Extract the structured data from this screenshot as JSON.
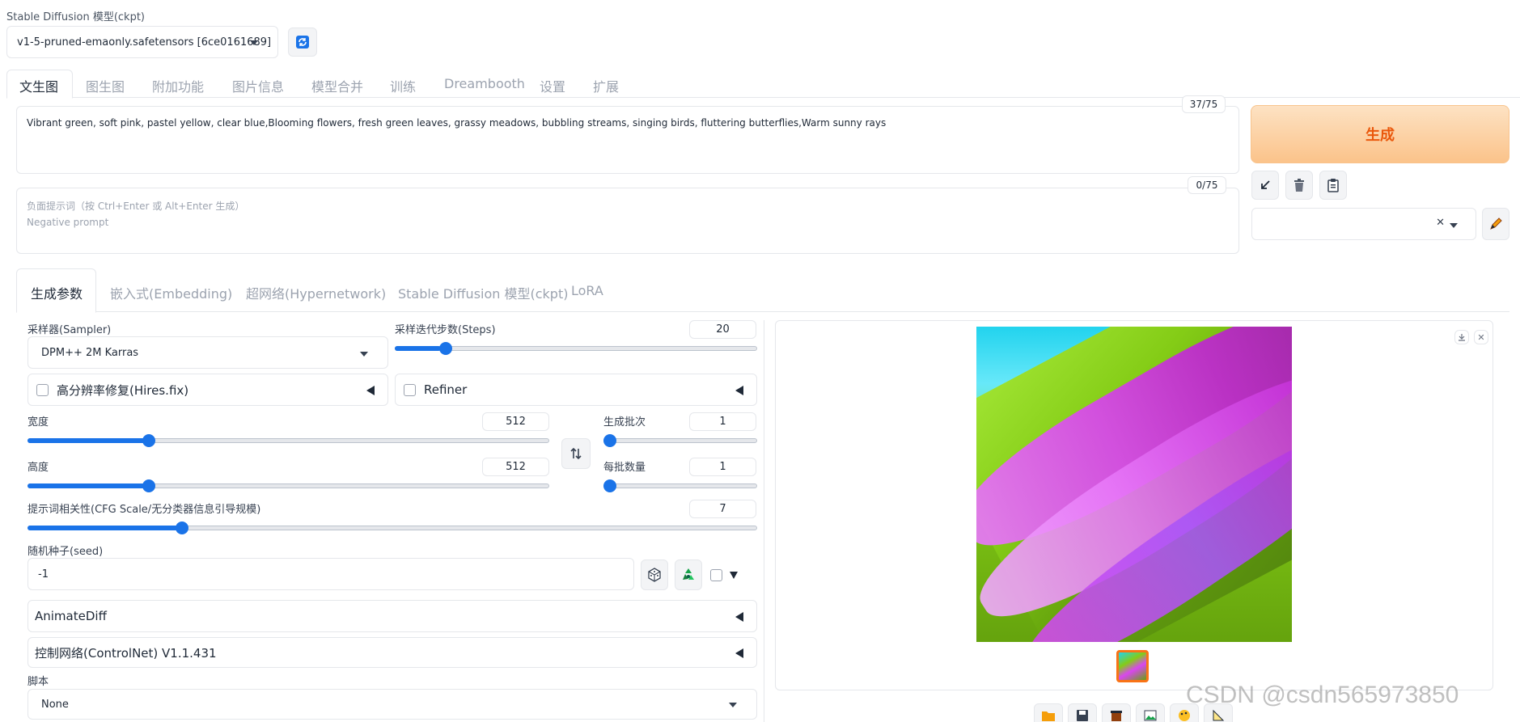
{
  "model": {
    "label": "Stable Diffusion 模型(ckpt)",
    "selected": "v1-5-pruned-emaonly.safetensors [6ce0161689]"
  },
  "main_tabs": [
    "文生图",
    "图生图",
    "附加功能",
    "图片信息",
    "模型合并",
    "训练",
    "Dreambooth",
    "设置",
    "扩展"
  ],
  "prompt": {
    "value": "Vibrant green, soft pink, pastel yellow, clear blue,Blooming flowers, fresh green leaves, grassy meadows, bubbling streams, singing birds, fluttering butterflies,Warm sunny rays",
    "counter": "37/75"
  },
  "negative_prompt": {
    "placeholder_line1": "负面提示词（按 Ctrl+Enter 或 Alt+Enter 生成）",
    "placeholder_line2": "Negative prompt",
    "counter": "0/75"
  },
  "generate_label": "生成",
  "sub_tabs": [
    "生成参数",
    "嵌入式(Embedding)",
    "超网络(Hypernetwork)",
    "Stable Diffusion 模型(ckpt)",
    "LoRA"
  ],
  "sampler": {
    "label": "采样器(Sampler)",
    "value": "DPM++ 2M Karras"
  },
  "steps": {
    "label": "采样迭代步数(Steps)",
    "value": "20",
    "min": 1,
    "max": 150,
    "current": 20
  },
  "hires": {
    "label": "高分辨率修复(Hires.fix)"
  },
  "refiner": {
    "label": "Refiner"
  },
  "width": {
    "label": "宽度",
    "value": "512",
    "min": 64,
    "max": 2048,
    "current": 512
  },
  "height": {
    "label": "高度",
    "value": "512",
    "min": 64,
    "max": 2048,
    "current": 512
  },
  "batch_count": {
    "label": "生成批次",
    "value": "1",
    "min": 1,
    "max": 100,
    "current": 1
  },
  "batch_size": {
    "label": "每批数量",
    "value": "1",
    "min": 1,
    "max": 8,
    "current": 1
  },
  "cfg": {
    "label": "提示词相关性(CFG Scale/无分类器信息引导规模)",
    "value": "7",
    "min": 1,
    "max": 30,
    "current": 7
  },
  "seed": {
    "label": "随机种子(seed)",
    "value": "-1"
  },
  "animatediff_label": "AnimateDiff",
  "controlnet_label": "控制网络(ControlNet) V1.1.431",
  "script": {
    "label": "脚本",
    "value": "None"
  },
  "watermark": "CSDN @csdn565973850",
  "colors": {
    "accent": "#1a73e8",
    "generate_bg": "#fcd3a6",
    "generate_text": "#ea580c"
  }
}
